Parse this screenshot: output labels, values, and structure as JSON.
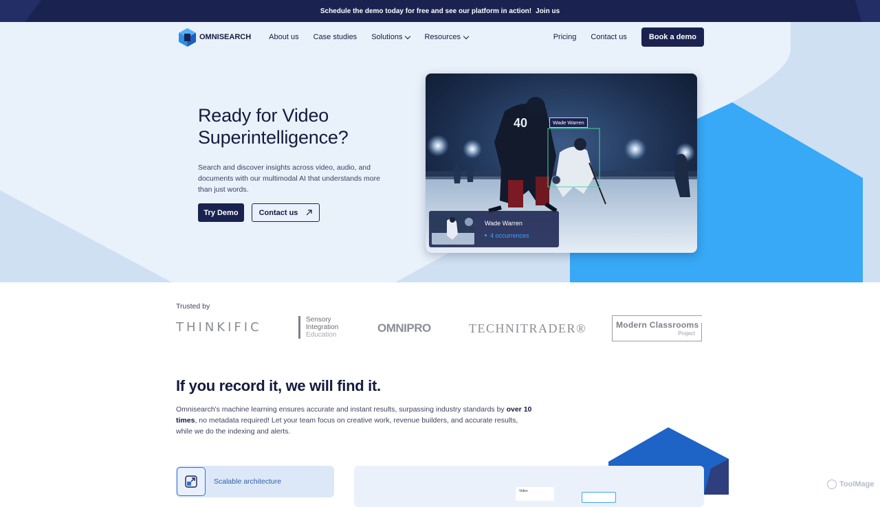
{
  "banner": {
    "text": "Schedule the demo today for free and see our platform in action!",
    "link": "Join us"
  },
  "nav": {
    "brand": "OMNISEARCH",
    "items": [
      {
        "label": "About us"
      },
      {
        "label": "Case studies"
      },
      {
        "label": "Solutions",
        "dropdown": true
      },
      {
        "label": "Resources",
        "dropdown": true
      }
    ],
    "pricing": "Pricing",
    "contact": "Contact us",
    "cta": "Book a demo"
  },
  "hero": {
    "title_line1": "Ready for Video",
    "title_line2": "Superintelligence?",
    "description": "Search and discover insights across video, audio, and documents with our multimodal AI that understands more than just words.",
    "primary_button": "Try Demo",
    "secondary_button": "Contact us",
    "video": {
      "jersey_number": "40",
      "tag": "Wade Warren",
      "result_name": "Wade Warren",
      "result_count": "4 occurrences"
    }
  },
  "trusted": {
    "label": "Trusted by",
    "logos": {
      "thinkific": "THINKIFIC",
      "sensory_line1": "Sensory",
      "sensory_line2": "Integration",
      "sensory_line3": "Education",
      "omnipro": "OMNIPRO",
      "technitrader": "TECHNITRADER®",
      "modern_line1": "Modern Classrooms",
      "modern_line2": "Project"
    }
  },
  "section": {
    "title": "If you record it, we will find it.",
    "body_part1": "Omnisearch's machine learning ensures accurate and instant results, surpassing industry standards by ",
    "body_bold": "over 10 times",
    "body_part2": ", no metadata required! Let your team focus on creative work, revenue builders, and accurate results, while we do the indexing and alerts."
  },
  "feature": {
    "label": "Scalable architecture"
  },
  "preview": {
    "mini_label": "Video"
  },
  "watermark": {
    "text": "ToolMage"
  },
  "colors": {
    "navy": "#1a2350",
    "accent_blue": "#38a9f6",
    "hero_bg": "#e9f1fb"
  }
}
